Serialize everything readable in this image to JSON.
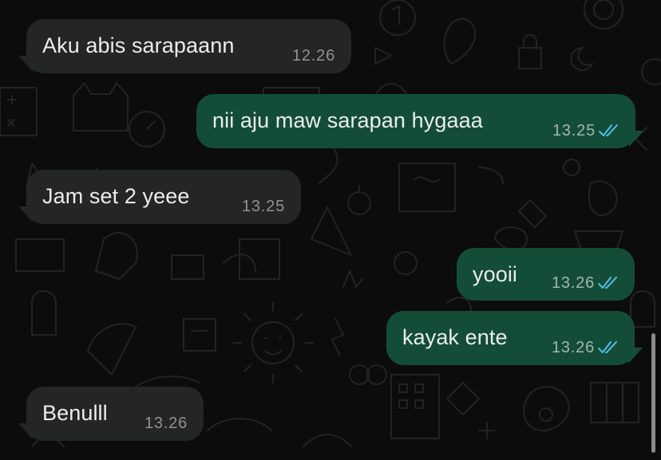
{
  "colors": {
    "background": "#0c0c0c",
    "incoming_bubble": "#242626",
    "outgoing_bubble": "#144d37",
    "text": "#e9edef",
    "time": "#8b9396",
    "read_ticks": "#53bdeb"
  },
  "messages": [
    {
      "direction": "incoming",
      "text": "Aku abis sarapaann",
      "time": "12.26"
    },
    {
      "direction": "outgoing",
      "text": "nii aju maw sarapan hygaaa",
      "time": "13.25",
      "status": "read",
      "status_icon": "double-check-icon"
    },
    {
      "direction": "incoming",
      "text": "Jam set 2 yeee",
      "time": "13.25"
    },
    {
      "direction": "outgoing",
      "text": "yooii",
      "time": "13.26",
      "status": "read",
      "status_icon": "double-check-icon"
    },
    {
      "direction": "outgoing",
      "text": "kayak ente",
      "time": "13.26",
      "status": "read",
      "status_icon": "double-check-icon"
    },
    {
      "direction": "incoming",
      "text": "Benulll",
      "time": "13.26"
    }
  ]
}
